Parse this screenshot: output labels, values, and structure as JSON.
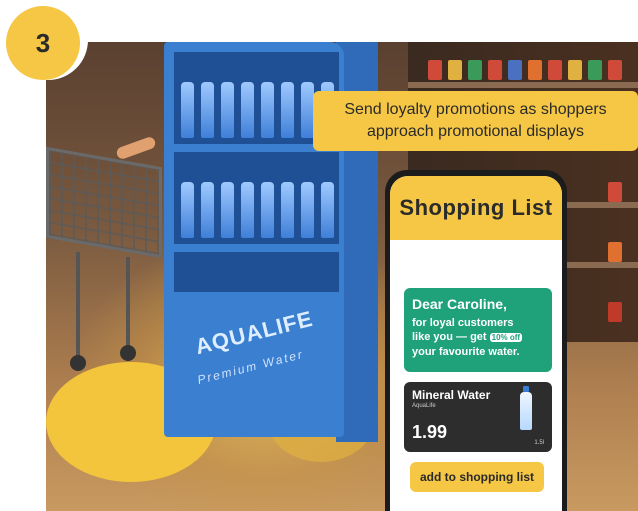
{
  "step": {
    "number": "3"
  },
  "banner": {
    "line1": "Send loyalty promotions as shoppers",
    "line2": "approach promotional displays"
  },
  "display": {
    "brand": "AQUALIFE",
    "tagline": "Premium Water"
  },
  "phone": {
    "title": "Shopping List",
    "promo": {
      "greeting": "Dear Caroline,",
      "line1": "for loyal customers",
      "line2_prefix": "like you — get",
      "discount": "10% off",
      "line3": "your favourite water."
    },
    "product": {
      "name": "Mineral Water",
      "subtitle": "AquaLife",
      "price": "1.99",
      "size": "1.5l",
      "icon": "water-bottle-icon"
    },
    "add_button": "add to shopping list"
  },
  "colors": {
    "accent": "#f5c744",
    "promo": "#1fa27a",
    "product_card": "#2d2d2d",
    "display_blue": "#3b7fd0"
  }
}
